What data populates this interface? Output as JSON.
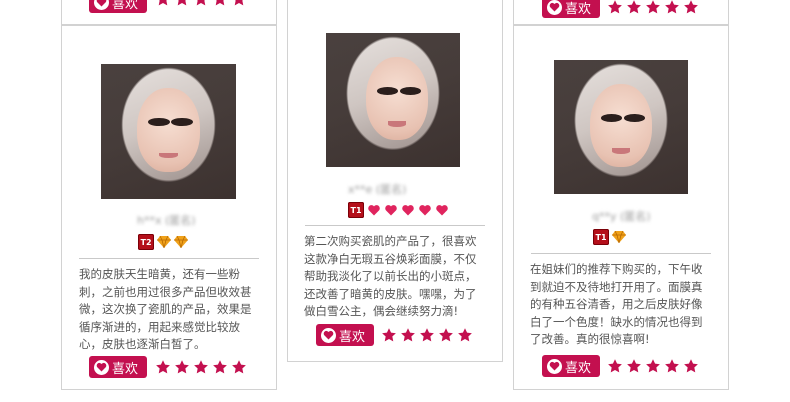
{
  "colors": {
    "accent": "#c3104f",
    "border": "#d2d2d2",
    "text": "#555555"
  },
  "cards": [
    {
      "nickname": "h**x (匿名)",
      "level": "T2",
      "review": "我的皮肤天生暗黄，还有一些粉刺，之前也用过很多产品但收效甚微，这次换了瓷肌的产品，效果是循序渐进的，用起来感觉比较放心，皮肤也逐渐白皙了。",
      "like_label": "喜欢",
      "rating": 5
    },
    {
      "nickname": "x**e (匿名)",
      "level": "T1",
      "review": "第二次购买瓷肌的产品了，很喜欢这款净白无瑕五谷焕彩面膜，不仅帮助我淡化了以前长出的小斑点，还改善了暗黄的皮肤。嘿嘿，为了做白雪公主，偶会继续努力滴!",
      "like_label": "喜欢",
      "rating": 5
    },
    {
      "nickname": "q**y (匿名)",
      "level": "T1",
      "review": "在姐妹们的推荐下购买的，下午收到就迫不及待地打开用了。面膜真的有种五谷清香，用之后皮肤好像白了一个色度！缺水的情况也得到了改善。真的很惊喜啊!",
      "like_label": "喜欢",
      "rating": 5
    }
  ],
  "top_row": {
    "like_label": "喜欢",
    "rating": 5
  }
}
